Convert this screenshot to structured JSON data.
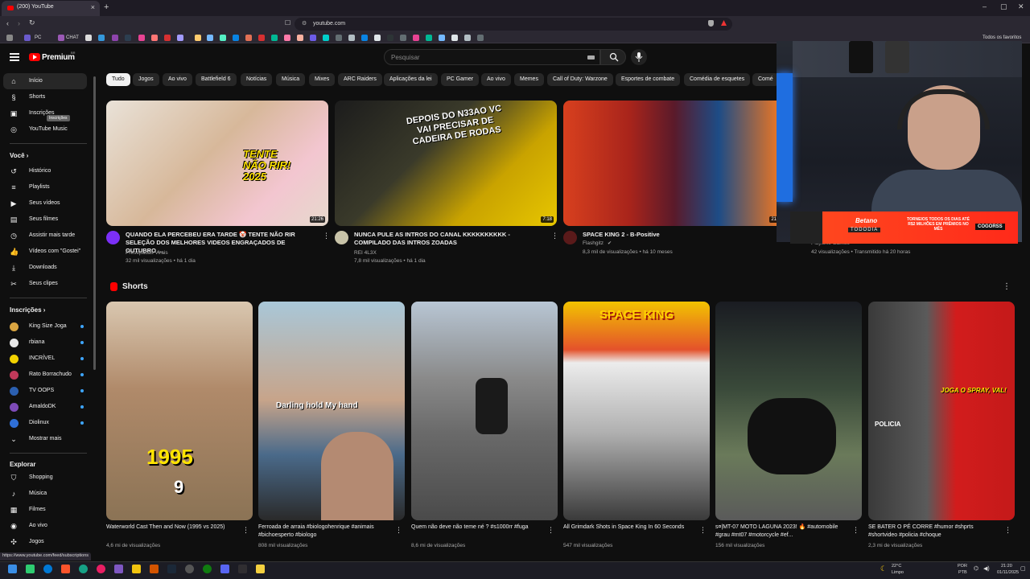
{
  "browser": {
    "tab_title": "(200) YouTube",
    "tab_close": "×",
    "new_tab": "+",
    "url": "youtube.com",
    "status_url": "https://www.youtube.com/feed/subscriptions",
    "bookmark_labels": [
      "PC",
      "CHAT"
    ],
    "favorites_label": "Todos os favoritos",
    "win_minimize": "–",
    "win_maximize": "▢",
    "win_close": "✕"
  },
  "header": {
    "brand": "Premium",
    "brand_sup": "BR",
    "search_placeholder": "Pesquisar"
  },
  "sidebar": {
    "main": [
      {
        "label": "Início",
        "icon": "home-icon"
      },
      {
        "label": "Shorts",
        "icon": "shorts-icon"
      },
      {
        "label": "Inscrições",
        "icon": "subscriptions-icon"
      },
      {
        "label": "YouTube Music",
        "icon": "music-icon"
      }
    ],
    "tooltip": "Inscrições",
    "you_title": "Você",
    "you": [
      {
        "label": "Histórico"
      },
      {
        "label": "Playlists"
      },
      {
        "label": "Seus vídeos"
      },
      {
        "label": "Seus filmes"
      },
      {
        "label": "Assistir mais tarde"
      },
      {
        "label": "Vídeos com \"Gostei\""
      },
      {
        "label": "Downloads"
      },
      {
        "label": "Seus clipes"
      }
    ],
    "subs_title": "Inscrições",
    "subs": [
      {
        "label": "King Size Joga",
        "color": "#d9a441"
      },
      {
        "label": "rbiana",
        "color": "#e8e8e8"
      },
      {
        "label": "INCRÍVEL",
        "color": "#f2d200"
      },
      {
        "label": "Rato Borrachudo",
        "color": "#c0395a"
      },
      {
        "label": "TV OOPS",
        "color": "#2b5fb0"
      },
      {
        "label": "AmaldoDK",
        "color": "#7e4bb8"
      },
      {
        "label": "Diolinux",
        "color": "#2f6fd6"
      }
    ],
    "show_more": "Mostrar mais",
    "explore_title": "Explorar",
    "explore": [
      {
        "label": "Shopping"
      },
      {
        "label": "Música"
      },
      {
        "label": "Filmes"
      },
      {
        "label": "Ao vivo"
      },
      {
        "label": "Jogos"
      }
    ]
  },
  "chips": [
    "Tudo",
    "Jogos",
    "Ao vivo",
    "Battlefield 6",
    "Notícias",
    "Música",
    "Mixes",
    "ARC Raiders",
    "Aplicações da lei",
    "PC Gamer",
    "Ao vivo",
    "Memes",
    "Call of Duty: Warzone",
    "Esportes de combate",
    "Comédia de esquetes",
    "Comé"
  ],
  "videos": [
    {
      "title": "QUANDO ELA PERCEBEU ERA TARDE 🤡 TENTE NÃO RIR SELEÇÃO DOS MELHORES VIDEOS ENGRAÇADOS DE OUTUBRO ...",
      "channel": "Presepadas Virais",
      "meta": "32 mil visualizações • há 1 dia",
      "duration": "21:26",
      "thumb_text": "TENTE NÃO RIR! 2025"
    },
    {
      "title": "NUNCA PULE AS INTROS DO CANAL KKKKKKKKKK - COMPILADO DAS INTROS ZOADAS",
      "channel": "REI 4L3X",
      "meta": "7,8 mil visualizações • há 1 dia",
      "duration": "7:18",
      "thumb_text": "DEPOIS DO N33AO VC VAI PRECISAR DE CADEIRA DE RODAS"
    },
    {
      "title": "SPACE KING 2 - B-Positive",
      "channel": "Flashgitz",
      "meta": "8,3 mil de visualizações • há 10 meses",
      "duration": "21:4",
      "thumb_text": ""
    },
    {
      "title": "",
      "channel": "Playtime Games",
      "meta": "42 visualizações • Transmitido há 20 horas",
      "duration": "",
      "thumb_text": ""
    }
  ],
  "shorts_title": "Shorts",
  "shorts": [
    {
      "title": "Waterworld Cast Then and Now (1995 vs 2025)",
      "views": "4,6 mi de visualizações",
      "thumb_text": "1995",
      "thumb_sub": "9"
    },
    {
      "title": "Ferroada de arraia #biologohenrique #animais #bichoesperto #biologo",
      "views": "808 mil visualizações",
      "thumb_text": "Darling hold My hand",
      "thumb_sub": ""
    },
    {
      "title": "Quem não deve não teme né ? #s1000rr #fuga",
      "views": "8,6 mi de visualizações",
      "thumb_text": "",
      "thumb_sub": ""
    },
    {
      "title": "All Grimdark Shots in Space King In 60 Seconds",
      "views": "547 mil visualizações",
      "thumb_text": "SPACE KING",
      "thumb_sub": ""
    },
    {
      "title": "s¤|MT-07 MOTO LAGUNA 2023! 🔥 #automobile #grau #mt07 #motorcycle #ef...",
      "views": "156 mil visualizações",
      "thumb_text": "",
      "thumb_sub": ""
    },
    {
      "title": "SE BATER O PÉ CORRE #humor #shprts #shortvideo #policia #choque",
      "views": "2,3 mi de visualizações",
      "thumb_text": "JOGA O SPRAY, VAL!",
      "thumb_sub": "POLICIA"
    }
  ],
  "promo": {
    "brand": "Betano",
    "code": "TODODIA",
    "text": "TORNEIOS TODOS OS DIAS ATÉ R$2 MILHÕES EM PRÊMIOS NO MÊS",
    "logo": "COGORSS"
  },
  "taskbar": {
    "weather_temp": "22°C",
    "weather_desc": "Limpo",
    "lang": "POR",
    "layout": "PTB",
    "time": "21:20",
    "date": "01/11/2025"
  }
}
